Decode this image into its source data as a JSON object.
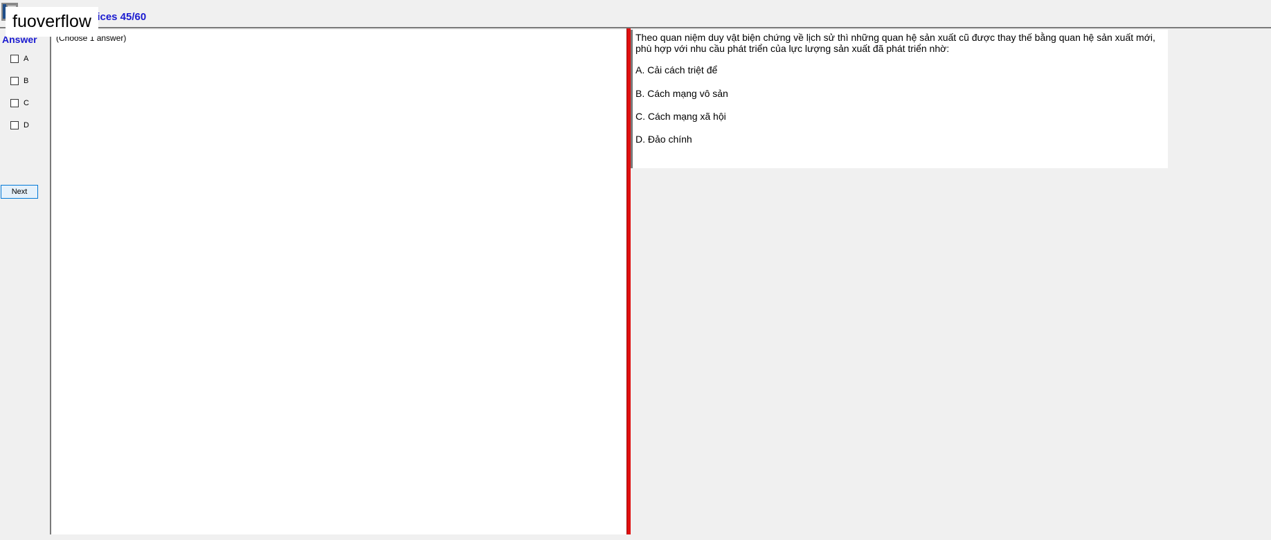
{
  "header": {
    "title": "hoices 45/60",
    "watermark": "fuoverflow"
  },
  "answer_panel": {
    "label": "Answer",
    "options": [
      {
        "label": "A",
        "checked": false
      },
      {
        "label": "B",
        "checked": false
      },
      {
        "label": "C",
        "checked": false
      },
      {
        "label": "D",
        "checked": false
      }
    ],
    "next_label": "Next"
  },
  "middle": {
    "hint": "(Choose 1 answer)"
  },
  "question": {
    "text": "Theo quan niệm duy vật biện chứng về lịch sử thì những quan hệ sản xuất cũ được thay thế bằng quan hệ sản xuất mới, phù hợp với nhu cầu phát triển của lực lượng sản xuất đã phát triển nhờ:",
    "choices": [
      "A.  Cải cách triệt để",
      "B.  Cách mạng vô sản",
      "C.  Cách mạng xã hội",
      "D.  Đảo chính"
    ]
  },
  "colors": {
    "accent_blue": "#1a1ad0",
    "splitter_red": "#e01010",
    "background": "#f0f0f0"
  }
}
